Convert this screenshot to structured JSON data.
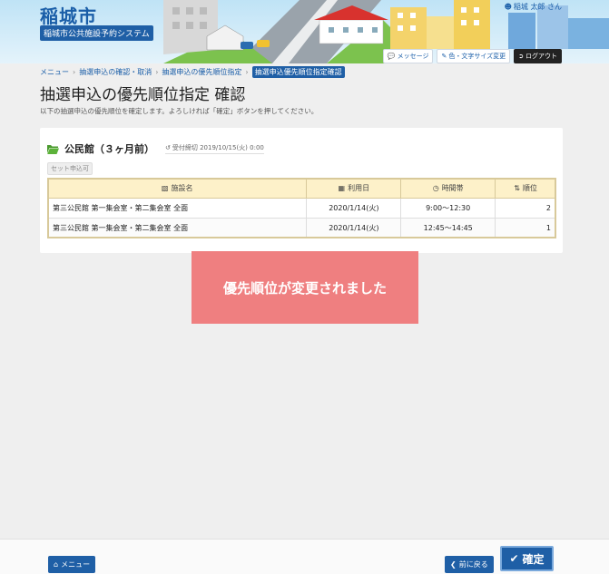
{
  "header": {
    "city": "稲城市",
    "system": "稲城市公共施設予約システム",
    "user": "稲城 太郎 さん",
    "buttons": {
      "message": "メッセージ",
      "color_font": "色・文字サイズ変更",
      "logout": "ログアウト"
    }
  },
  "breadcrumb": {
    "items": [
      "メニュー",
      "抽選申込の確認・取消",
      "抽選申込の優先順位指定"
    ],
    "current": "抽選申込優先順位指定確認"
  },
  "page": {
    "title": "抽選申込の優先順位指定 確認",
    "description": "以下の抽選申込の優先順位を確定します。よろしければ「確定」ボタンを押してください。"
  },
  "facility": {
    "name": "公民館（３ヶ月前）",
    "deadline": "受付締切 2019/10/15(火) 0:00",
    "tag": "セット申込可"
  },
  "table": {
    "headers": [
      "施設名",
      "利用日",
      "時間帯",
      "順位"
    ],
    "rows": [
      [
        "第三公民館 第一集会室・第二集会室 全面",
        "2020/1/14(火)",
        "9:00～12:30",
        "2"
      ],
      [
        "第三公民館 第一集会室・第二集会室 全面",
        "2020/1/14(火)",
        "12:45～14:45",
        "1"
      ]
    ]
  },
  "toast": "優先順位が変更されました",
  "footer": {
    "menu": "メニュー",
    "back": "前に戻る",
    "confirm": "確定"
  },
  "colors": {
    "primary": "#1f5fa6",
    "toast": "#ef7f80",
    "table_header": "#fdf1c9"
  }
}
